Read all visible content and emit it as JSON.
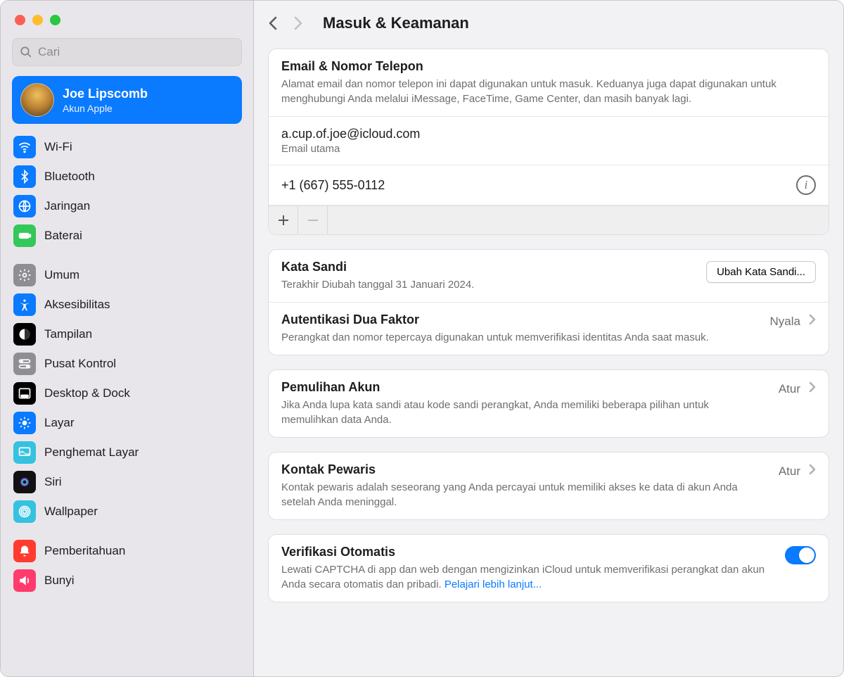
{
  "search": {
    "placeholder": "Cari"
  },
  "account": {
    "name": "Joe Lipscomb",
    "sub": "Akun Apple"
  },
  "sidebar": {
    "group1": [
      {
        "label": "Wi-Fi",
        "icon": "wifi",
        "color": "#0a7aff"
      },
      {
        "label": "Bluetooth",
        "icon": "bluetooth",
        "color": "#0a7aff"
      },
      {
        "label": "Jaringan",
        "icon": "globe",
        "color": "#0a7aff"
      },
      {
        "label": "Baterai",
        "icon": "battery",
        "color": "#34c759"
      }
    ],
    "group2": [
      {
        "label": "Umum",
        "icon": "gear",
        "color": "#8e8e93"
      },
      {
        "label": "Aksesibilitas",
        "icon": "accessibility",
        "color": "#0a7aff"
      },
      {
        "label": "Tampilan",
        "icon": "appearance",
        "color": "#000000"
      },
      {
        "label": "Pusat Kontrol",
        "icon": "switches",
        "color": "#8e8e93"
      },
      {
        "label": "Desktop & Dock",
        "icon": "dock",
        "color": "#000000"
      },
      {
        "label": "Layar",
        "icon": "brightness",
        "color": "#0a7aff"
      },
      {
        "label": "Penghemat Layar",
        "icon": "screensaver",
        "color": "#35c2e0"
      },
      {
        "label": "Siri",
        "icon": "siri",
        "color": "#111111"
      },
      {
        "label": "Wallpaper",
        "icon": "wallpaper",
        "color": "#35c2e0"
      }
    ],
    "group3": [
      {
        "label": "Pemberitahuan",
        "icon": "bell",
        "color": "#ff3b30"
      },
      {
        "label": "Bunyi",
        "icon": "sound",
        "color": "#ff3b6e"
      }
    ]
  },
  "header": {
    "title": "Masuk & Keamanan"
  },
  "email_section": {
    "title": "Email & Nomor Telepon",
    "desc": "Alamat email dan nomor telepon ini dapat digunakan untuk masuk. Keduanya juga dapat digunakan untuk menghubungi Anda melalui iMessage, FaceTime, Game Center, dan masih banyak lagi.",
    "email": "a.cup.of.joe@icloud.com",
    "email_sub": "Email utama",
    "phone": "+1 (667) 555-0112"
  },
  "password": {
    "title": "Kata Sandi",
    "desc": "Terakhir Diubah tanggal 31 Januari 2024.",
    "button": "Ubah Kata Sandi..."
  },
  "twofa": {
    "title": "Autentikasi Dua Faktor",
    "desc": "Perangkat dan nomor tepercaya digunakan untuk memverifikasi identitas Anda saat masuk.",
    "status": "Nyala"
  },
  "recovery": {
    "title": "Pemulihan Akun",
    "desc": "Jika Anda lupa kata sandi atau kode sandi perangkat, Anda memiliki beberapa pilihan untuk memulihkan data Anda.",
    "status": "Atur"
  },
  "legacy": {
    "title": "Kontak Pewaris",
    "desc": "Kontak pewaris adalah seseorang yang Anda percayai untuk memiliki akses ke data di akun Anda setelah Anda meninggal.",
    "status": "Atur"
  },
  "autoverify": {
    "title": "Verifikasi Otomatis",
    "desc": "Lewati CAPTCHA di app dan web dengan mengizinkan iCloud untuk memverifikasi perangkat dan akun Anda secara otomatis dan pribadi. ",
    "link": "Pelajari lebih lanjut..."
  }
}
